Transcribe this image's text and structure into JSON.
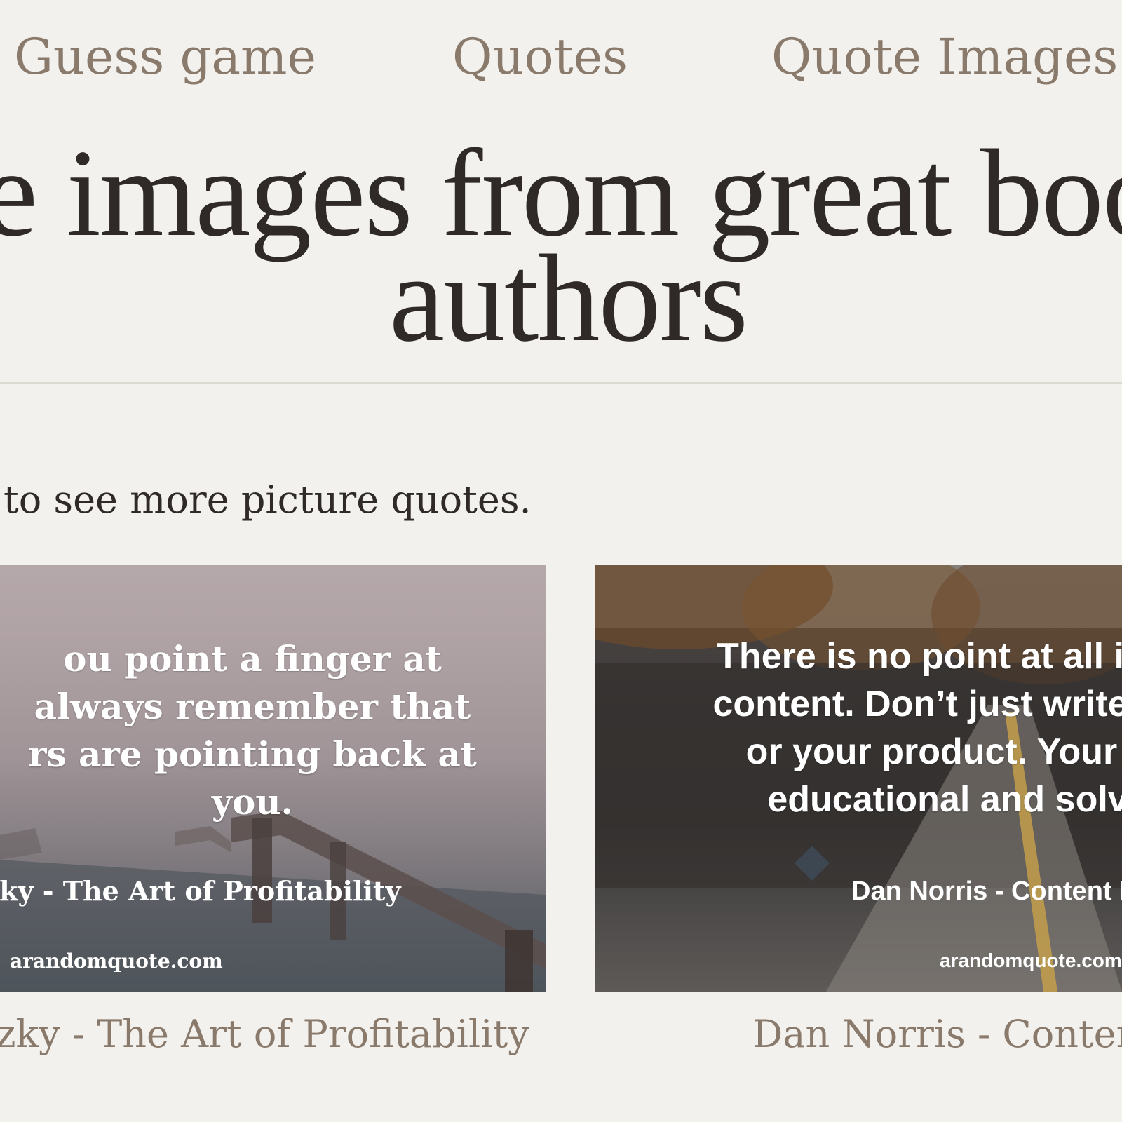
{
  "nav": {
    "items": [
      {
        "label": "Guess game"
      },
      {
        "label": "Quotes"
      },
      {
        "label": "Quote Images"
      }
    ]
  },
  "heading": {
    "line1": "e images from great book",
    "line2": "authors"
  },
  "intro": "to see more picture quotes.",
  "cards": [
    {
      "quote": "ou point a finger at\nalways remember that\nrs are pointing back at\nyou.",
      "attribution": "tzky - The Art of Profitability",
      "site": "arandomquote.com",
      "caption": "zky - The Art of Profitability"
    },
    {
      "quote": "There is no point at all in ge\ncontent. Don’t just write abo\nor your product. Your co\neducational and solve",
      "attribution": "Dan Norris - Content M",
      "site": "arandomquote.com",
      "caption": "Dan Norris - Conten"
    }
  ]
}
